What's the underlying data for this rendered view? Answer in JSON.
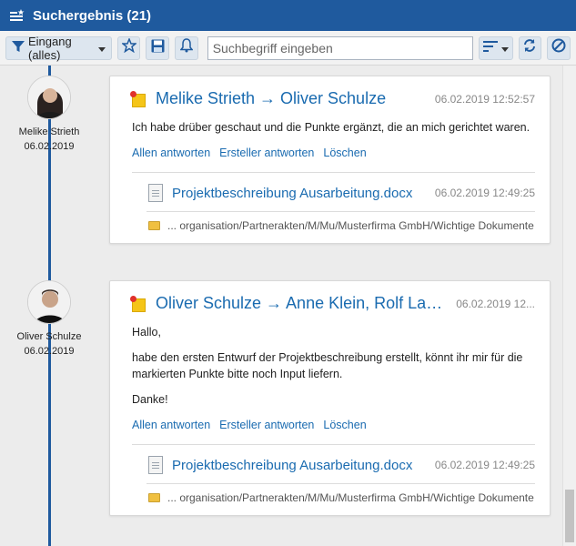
{
  "header": {
    "title": "Suchergebnis (21)"
  },
  "toolbar": {
    "filter_label": "Eingang (alles)",
    "search_placeholder": "Suchbegriff eingeben"
  },
  "entries": [
    {
      "author": "Melike Strieth",
      "author_date": "06.02.2019",
      "title": "Melike Strieth → Oliver Schulze",
      "date": "06.02.2019 12:52:57",
      "body": [
        "Ich habe drüber geschaut und die Punkte ergänzt, die an mich gerichtet waren."
      ],
      "actions": [
        "Allen antworten",
        "Ersteller antworten",
        "Löschen"
      ],
      "attachment": {
        "name": "Projektbeschreibung Ausarbeitung.docx",
        "date": "06.02.2019 12:49:25"
      },
      "path": "... organisation/Partnerakten/M/Mu/Musterfirma GmbH/Wichtige Dokumente"
    },
    {
      "author": "Oliver Schulze",
      "author_date": "06.02.2019",
      "title": "Oliver Schulze → Anne Klein, Rolf Lang, ...",
      "date": "06.02.2019 12...",
      "body": [
        "Hallo,",
        "habe den ersten Entwurf der Projektbeschreibung erstellt, könnt ihr mir für die markierten Punkte bitte noch Input liefern.",
        "Danke!"
      ],
      "actions": [
        "Allen antworten",
        "Ersteller antworten",
        "Löschen"
      ],
      "attachment": {
        "name": "Projektbeschreibung Ausarbeitung.docx",
        "date": "06.02.2019 12:49:25"
      },
      "path": "... organisation/Partnerakten/M/Mu/Musterfirma GmbH/Wichtige Dokumente"
    }
  ],
  "colors": {
    "brand": "#1f5a9e",
    "link": "#1a6bb0"
  }
}
